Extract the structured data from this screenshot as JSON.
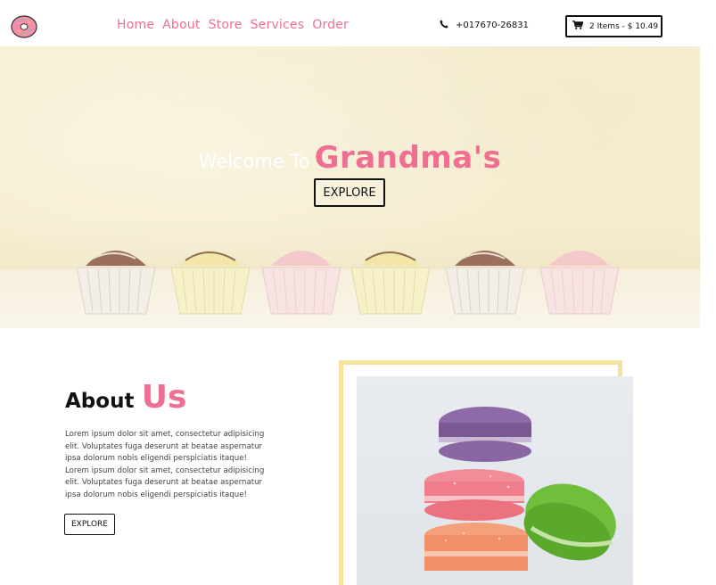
{
  "nav": {
    "links": [
      "Home",
      "About",
      "Store",
      "Services",
      "Order"
    ],
    "phone": "+017670-26831",
    "cart_label": "2 Items - $ 10.49"
  },
  "hero": {
    "welcome": "Welcome To",
    "brand": "Grandma's",
    "button": "EXPLORE"
  },
  "about": {
    "title_part1": "About",
    "title_part2": "Us",
    "paragraph": "Lorem ipsum dolor sit amet, consectetur adipisicing elit. Voluptates fuga deserunt at beatae aspernatur ipsa dolorum nobis eligendi perspiciatis itaque! Lorem ipsum dolor sit amet, consectetur adipisicing elit. Voluptates fuga deserunt at beatae aspernatur ipsa dolorum nobis eligendi perspiciatis itaque!",
    "button": "EXPLORE"
  },
  "icons": {
    "logo": "donut-icon",
    "phone": "phone-icon",
    "cart": "cart-icon"
  },
  "colors": {
    "accent_pink": "#ef6f93",
    "frame_yellow": "#f6e29e",
    "hero_bg": "#f7f0d3"
  }
}
